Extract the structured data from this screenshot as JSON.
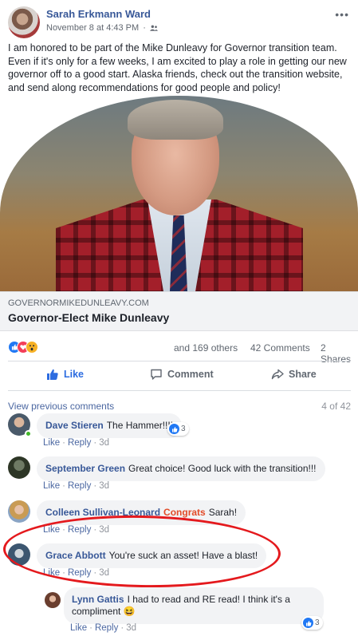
{
  "post": {
    "author": "Sarah Erkmann Ward",
    "timestamp": "November 8 at 4:43 PM",
    "separator": "·",
    "audience_icon": "friends-icon",
    "more_icon": "more-options-icon",
    "more_glyph": "•••",
    "text": "I am honored to be part of the Mike Dunleavy for Governor transition team. Even if it's only for a few weeks, I am excited to play a role in getting our new governor off to a good start. Alaska friends, check out the transition website, and send along recommendations for good people and policy!"
  },
  "link_preview": {
    "domain": "GOVERNORMIKEDUNLEAVY.COM",
    "title": "Governor-Elect Mike Dunleavy"
  },
  "stats": {
    "reactions_text": "and 169 others",
    "comments_text": "42 Comments",
    "shares_text": "2 Shares",
    "reaction_types": [
      "like",
      "love",
      "wow"
    ]
  },
  "actions": {
    "like": "Like",
    "comment": "Comment",
    "share": "Share"
  },
  "comments_section": {
    "view_previous": "View previous comments",
    "count_of": "4 of 42",
    "items": [
      {
        "name": "Dave Stieren",
        "text": "The Hammer!!!!",
        "like": "Like",
        "reply": "Reply",
        "time": "3d",
        "reactions": "3"
      },
      {
        "name": "September Green",
        "text": "Great choice! Good luck with the transition!!!",
        "like": "Like",
        "reply": "Reply",
        "time": "3d"
      },
      {
        "name": "Colleen Sullivan-Leonard",
        "tag": "Congrats",
        "text": "Sarah!",
        "like": "Like",
        "reply": "Reply",
        "time": "3d"
      },
      {
        "name": "Grace Abbott",
        "text": "You're suck an asset! Have a blast!",
        "like": "Like",
        "reply": "Reply",
        "time": "3d"
      }
    ],
    "reply": {
      "name": "Lynn Gattis",
      "text": "I had to read and RE read! I think it's a compliment 😆",
      "like": "Like",
      "reply": "Reply",
      "time": "3d",
      "reactions": "3"
    }
  },
  "colors": {
    "link_blue": "#385898",
    "like_blue": "#2078f4",
    "highlight_red": "#e4191d"
  }
}
